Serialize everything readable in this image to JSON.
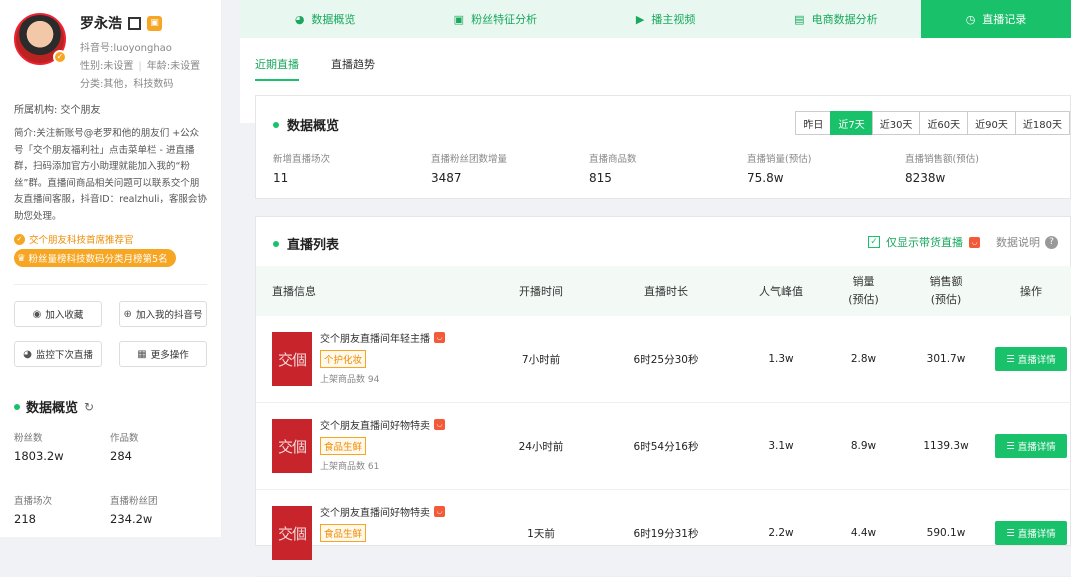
{
  "profile": {
    "name": "罗永浩",
    "douyin_id": "抖音号:luoyonghao",
    "gender": "性别:未设置",
    "age": "年龄:未设置",
    "category": "分类:其他，科技数码",
    "org": "所属机构: 交个朋友",
    "intro": "简介:",
    "intro_text": "关注新账号@老罗和他的朋友们 +公众号「交个朋友福利社」点击菜单栏 - 进直播群，扫码添加官方小助理就能加入我的“粉丝”群。直播间商品相关问题可以联系交个朋友直播间客服，抖音ID：realzhuli，客服会协助您处理。",
    "recommend": "交个朋友科技首席推荐官",
    "rank_badge": "粉丝量榜科技数码分类月榜第5名"
  },
  "actions": {
    "collect": "加入收藏",
    "add_my": "加入我的抖音号",
    "monitor": "监控下次直播",
    "more": "更多操作"
  },
  "side_overview": {
    "title": "数据概览",
    "stats": [
      {
        "label": "粉丝数",
        "value": "1803.2w"
      },
      {
        "label": "作品数",
        "value": "284"
      },
      {
        "label": "直播场次",
        "value": "218"
      },
      {
        "label": "直播粉丝团",
        "value": "234.2w"
      }
    ]
  },
  "tabs": [
    {
      "label": "数据概览",
      "icon": "pie-icon"
    },
    {
      "label": "粉丝特征分析",
      "icon": "id-card-icon"
    },
    {
      "label": "播主视频",
      "icon": "video-icon"
    },
    {
      "label": "电商数据分析",
      "icon": "bag-icon"
    },
    {
      "label": "直播记录",
      "icon": "clock-icon"
    }
  ],
  "subtabs": [
    "近期直播",
    "直播趋势"
  ],
  "overview": {
    "title": "数据概览",
    "periods": [
      "昨日",
      "近7天",
      "近30天",
      "近60天",
      "近90天",
      "近180天"
    ],
    "active_period": "近7天",
    "items": [
      {
        "label": "新增直播场次",
        "value": "11"
      },
      {
        "label": "直播粉丝团数增量",
        "value": "3487"
      },
      {
        "label": "直播商品数",
        "value": "815"
      },
      {
        "label": "直播销量(预估)",
        "value": "75.8w"
      },
      {
        "label": "直播销售额(预估)",
        "value": "8238w"
      }
    ]
  },
  "live_list": {
    "title": "直播列表",
    "only_goods": "仅显示带货直播",
    "explain": "数据说明",
    "columns": {
      "info": "直播信息",
      "time": "开播时间",
      "duration": "直播时长",
      "peak": "人气峰值",
      "sales_1": "销量",
      "sales_2": "(预估)",
      "amount_1": "销售额",
      "amount_2": "(预估)",
      "op": "操作"
    },
    "detail_label": "直播详情",
    "rows": [
      {
        "title": "交个朋友直播间年轻主播",
        "tag": "个护化妆",
        "goods": "上架商品数 94",
        "time": "7小时前",
        "duration": "6时25分30秒",
        "peak": "1.3w",
        "sales": "2.8w",
        "amount": "301.7w"
      },
      {
        "title": "交个朋友直播间好物特卖",
        "tag": "食品生鲜",
        "goods": "上架商品数 61",
        "time": "24小时前",
        "duration": "6时54分16秒",
        "peak": "3.1w",
        "sales": "8.9w",
        "amount": "1139.3w"
      },
      {
        "title": "交个朋友直播间好物特卖",
        "tag": "食品生鲜",
        "goods": "",
        "time": "1天前",
        "duration": "6时19分31秒",
        "peak": "2.2w",
        "sales": "4.4w",
        "amount": "590.1w"
      }
    ],
    "thumb_text": "交個"
  }
}
